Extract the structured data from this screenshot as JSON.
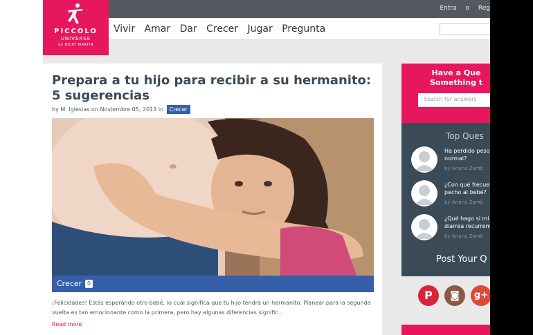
{
  "header": {
    "links": [
      "Entra",
      "o",
      "Reg"
    ],
    "nav": [
      "Vivir",
      "Amar",
      "Dar",
      "Crecer",
      "Jugar",
      "Pregunta"
    ]
  },
  "logo": {
    "name": "PICCOLO",
    "sub": "UNIVERSE",
    "by": "by RICKY MARTIN",
    "color": "#e6175c"
  },
  "article": {
    "title": "Prepara a tu hijo para recibir a su hermanito: 5 sugerencias",
    "byline": "by M. Iglesias on Noviembre 05, 2013 in",
    "category_tag": "Crecer",
    "category_bar": "Crecer",
    "category_count": "0",
    "excerpt": "¡Felicidades! Estás esperando otro bebé, lo cual significa que tu hijo tendrá un hermanito. Planear para la segunda vuelta es tan emocionante como la primera, pero hay algunas diferencias signific...",
    "read_more": "Read more"
  },
  "sidebar": {
    "ask_title_1": "Have a Que",
    "ask_title_2": "Something t",
    "search_placeholder": "Search for answers",
    "top_questions": "Top Ques",
    "questions": [
      {
        "line1": "Ha perdido peso",
        "line2": "normal?",
        "author": "by Ariana Zamb"
      },
      {
        "line1": "¿Con qué frecuer",
        "line2": "pecho al bebé?",
        "author": "by Ariana Zamb"
      },
      {
        "line1": "¿Qué hago si mi",
        "line2": "diarrea recurrem",
        "author": "by Ariana Zamb"
      }
    ],
    "post": "Post Your Q"
  },
  "social": {
    "pinterest": "P",
    "instagram": "◙",
    "google": "g+"
  },
  "colors": {
    "brand_pink": "#e6175c",
    "brand_blue": "#3560a9",
    "sidebar_dark": "#3a4a57",
    "topbar": "#55585f"
  }
}
